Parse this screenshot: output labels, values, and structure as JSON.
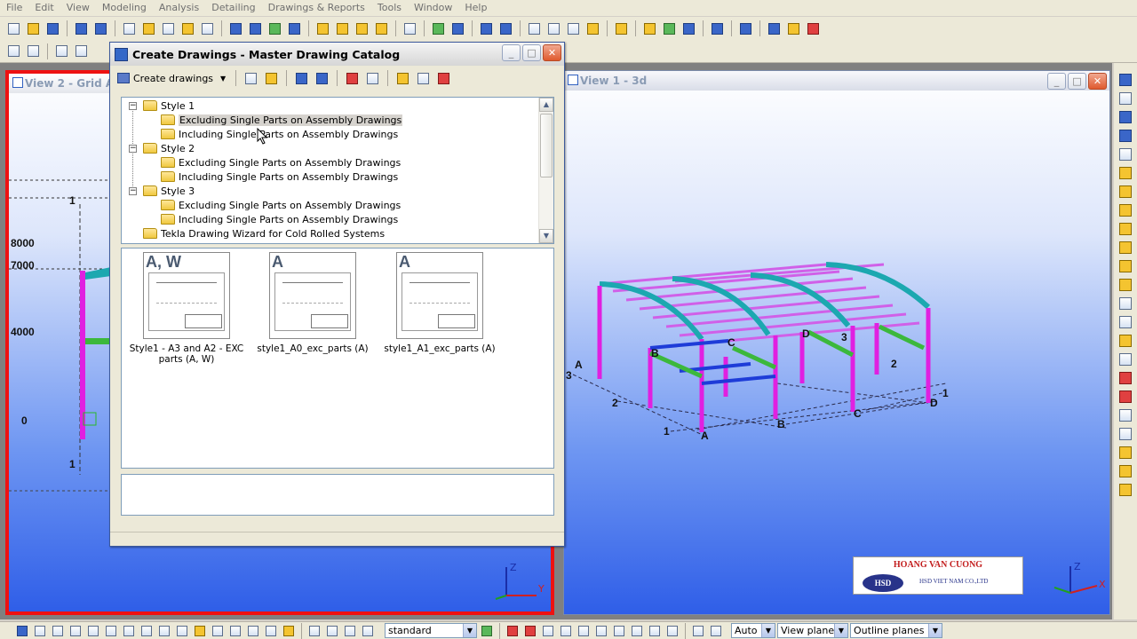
{
  "menu": [
    "File",
    "Edit",
    "View",
    "Modeling",
    "Analysis",
    "Detailing",
    "Drawings & Reports",
    "Tools",
    "Window",
    "Help"
  ],
  "view2": {
    "title": "View 2 - Grid A",
    "elevations": [
      "8000",
      "7000",
      "4000",
      "0"
    ],
    "grid_labels": [
      "1",
      "1"
    ],
    "axes": {
      "z": "Z",
      "y": "Y"
    }
  },
  "view1": {
    "title": "View 1 - 3d",
    "grid_labels": [
      "A",
      "3",
      "2",
      "1",
      "B",
      "C",
      "D",
      "3",
      "2",
      "1",
      "A",
      "B",
      "C",
      "D"
    ],
    "axes": {
      "z": "Z",
      "x": "X"
    }
  },
  "dialog": {
    "title": "Create Drawings - Master Drawing Catalog",
    "create_drawings_label": "Create drawings",
    "tree": [
      {
        "label": "Style 1"
      },
      {
        "label": "Excluding Single Parts on Assembly Drawings",
        "selected": true
      },
      {
        "label": "Including Single Parts on Assembly Drawings"
      },
      {
        "label": "Style 2"
      },
      {
        "label": "Excluding Single Parts on Assembly Drawings"
      },
      {
        "label": "Including Single Parts on Assembly Drawings"
      },
      {
        "label": "Style 3"
      },
      {
        "label": "Excluding Single Parts on Assembly Drawings"
      },
      {
        "label": "Including Single Parts on Assembly Drawings"
      },
      {
        "label": "Tekla Drawing Wizard for Cold Rolled Systems"
      }
    ],
    "thumbnails": [
      {
        "badge": "A, W",
        "caption": "Style1 - A3 and A2 - EXC parts  (A, W)"
      },
      {
        "badge": "A",
        "caption": "style1_A0_exc_parts (A)"
      },
      {
        "badge": "A",
        "caption": "style1_A1_exc_parts (A)"
      }
    ]
  },
  "bottombar": {
    "standard": "standard",
    "auto": "Auto",
    "view_plane": "View plane",
    "outline_planes": "Outline planes"
  },
  "logo": {
    "name": "HOANG VAN CUONG",
    "mark": "HSD",
    "company": "HSD VIET NAM CO.,LTD"
  },
  "colors": {
    "column": "#e020e0",
    "beam_teal": "#1ca8b0",
    "beam_green": "#3cb83c",
    "beam_blue": "#1e3cd8",
    "purlin": "#d060e8",
    "border_active": "#ee1111"
  }
}
